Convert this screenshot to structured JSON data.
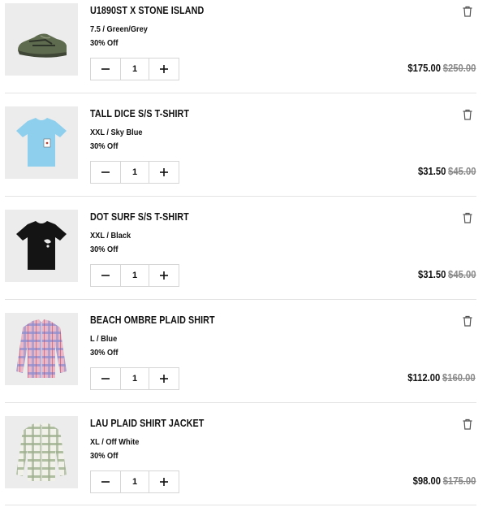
{
  "cart": {
    "items": [
      {
        "title": "U1890ST X STONE ISLAND",
        "variant": "7.5 / Green/Grey",
        "discount": "30% Off",
        "quantity": "1",
        "sale_price": "$175.00",
        "original_price": "$250.00",
        "image": "green-sneaker"
      },
      {
        "title": "TALL DICE S/S T-SHIRT",
        "variant": "XXL / Sky Blue",
        "discount": "30% Off",
        "quantity": "1",
        "sale_price": "$31.50",
        "original_price": "$45.00",
        "image": "sky-blue-tshirt"
      },
      {
        "title": "DOT SURF S/S T-SHIRT",
        "variant": "XXL / Black",
        "discount": "30% Off",
        "quantity": "1",
        "sale_price": "$31.50",
        "original_price": "$45.00",
        "image": "black-tshirt"
      },
      {
        "title": "BEACH OMBRE PLAID SHIRT",
        "variant": "L / Blue",
        "discount": "30% Off",
        "quantity": "1",
        "sale_price": "$112.00",
        "original_price": "$160.00",
        "image": "plaid-shirt"
      },
      {
        "title": "LAU PLAID SHIRT JACKET",
        "variant": "XL / Off White",
        "discount": "30% Off",
        "quantity": "1",
        "sale_price": "$98.00",
        "original_price": "$175.00",
        "image": "plaid-shirt-jacket"
      }
    ],
    "icons": {
      "decrease": "minus-icon",
      "increase": "plus-icon",
      "remove": "trash-icon"
    },
    "colors": {
      "text": "#111111",
      "strikethrough_price": "#8a8a8a",
      "thumbnail_bg": "#ececec",
      "divider": "#e3e3e3"
    }
  }
}
